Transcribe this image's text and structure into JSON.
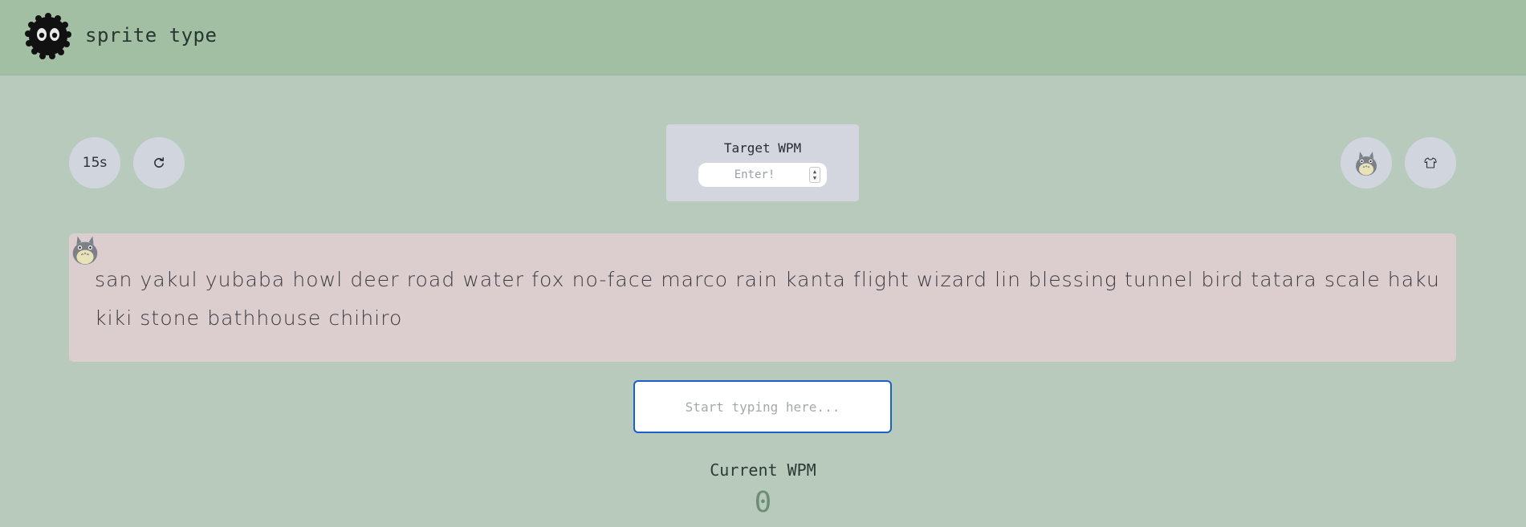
{
  "header": {
    "title": "sprite type",
    "logo_icon": "soot-sprite-icon",
    "background": "#a2bfa3"
  },
  "controls": {
    "timer_label": "15s",
    "refresh_icon": "refresh-icon",
    "mascot_icon": "totoro-icon",
    "theme_icon": "shirt-icon"
  },
  "target_wpm": {
    "label": "Target WPM",
    "placeholder": "Enter!"
  },
  "words": {
    "text": "san yakul yubaba howl deer road water fox no-face marco rain kanta flight wizard lin blessing tunnel bird tatara scale haku kiki stone bathhouse chihiro",
    "mascot_icon": "totoro-icon",
    "background": "#dccdcf"
  },
  "typing": {
    "placeholder": "Start typing here..."
  },
  "stats": {
    "current_wpm_label": "Current WPM",
    "current_wpm_value": "0"
  },
  "colors": {
    "page_background": "#b8cabb",
    "button_background": "#d1d6de",
    "input_focus_border": "#1a5fc8",
    "wpm_value": "#6c8e74"
  }
}
